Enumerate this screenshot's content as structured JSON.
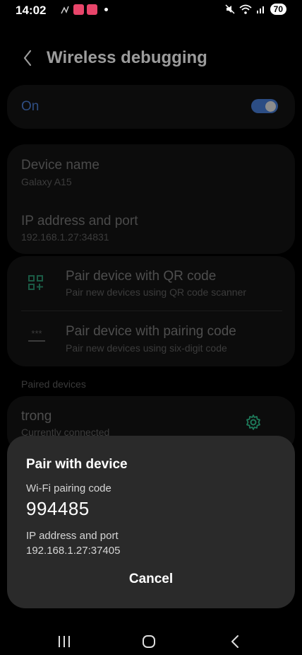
{
  "status_bar": {
    "time": "14:02",
    "battery": "70"
  },
  "header": {
    "title": "Wireless debugging"
  },
  "toggle_row": {
    "label": "On",
    "state": "on"
  },
  "device_info": {
    "device_name_label": "Device name",
    "device_name_value": "Galaxy A15",
    "ip_label": "IP address and port",
    "ip_value": "192.168.1.27:34831"
  },
  "pair_options": [
    {
      "title": "Pair device with QR code",
      "subtitle": "Pair new devices using QR code scanner"
    },
    {
      "title": "Pair device with pairing code",
      "subtitle": "Pair new devices using six-digit code"
    }
  ],
  "pair_code_icon_text": "***",
  "paired_section": {
    "header": "Paired devices",
    "devices": [
      {
        "name": "trong",
        "status": "Currently connected"
      }
    ]
  },
  "dialog": {
    "title": "Pair with device",
    "code_label": "Wi-Fi pairing code",
    "code": "994485",
    "ip_label": "IP address and port",
    "ip_value": "192.168.1.27:37405",
    "cancel_label": "Cancel"
  },
  "colors": {
    "accent_dim": "#2c4d84",
    "settings_icon": "#1e7a5a",
    "dialog_bg": "#2a2a2a"
  }
}
